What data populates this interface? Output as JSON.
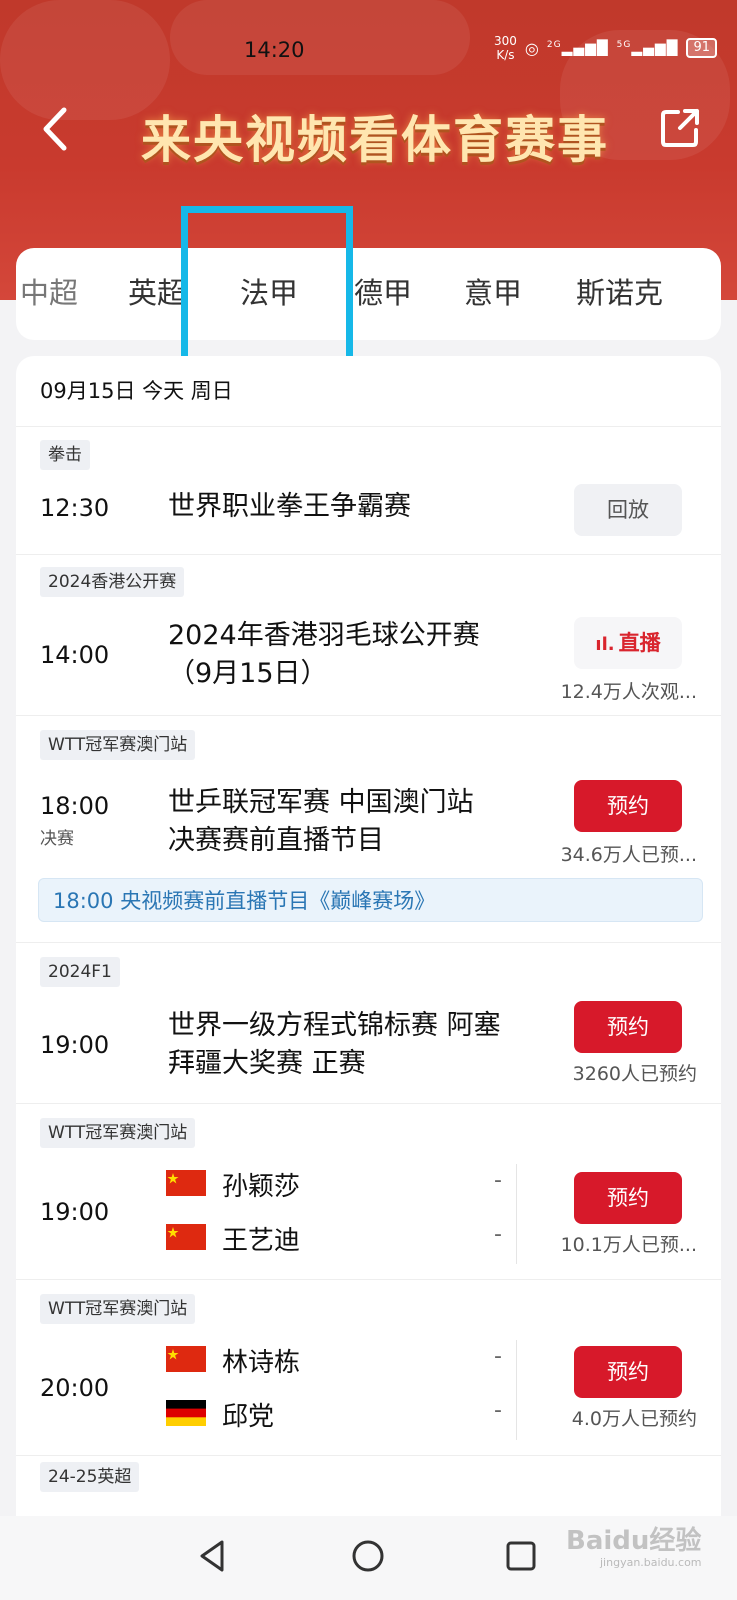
{
  "status": {
    "time": "14:20",
    "net_speed": "300",
    "net_unit": "K/s",
    "sig1": "2G",
    "sig2": "5G",
    "battery": "91"
  },
  "header": {
    "title": "来央视频看体育赛事"
  },
  "tabs": [
    "中超",
    "英超",
    "法甲",
    "德甲",
    "意甲",
    "斯诺克"
  ],
  "date_header": "09月15日 今天 周日",
  "events": [
    {
      "tag": "拳击",
      "time": "12:30",
      "name": "世界职业拳王争霸赛",
      "button": "回放"
    },
    {
      "tag": "2024香港公开赛",
      "time": "14:00",
      "name_line1": "2024年香港羽毛球公开赛",
      "name_line2": "（9月15日）",
      "button": "直播",
      "count": "12.4万人次观..."
    },
    {
      "tag": "WTT冠军赛澳门站",
      "time": "18:00",
      "sub": "决赛",
      "name_line1": "世乒联冠军赛 中国澳门站",
      "name_line2": "决赛赛前直播节目",
      "button": "预约",
      "count": "34.6万人已预...",
      "note": "18:00 央视频赛前直播节目《巅峰赛场》"
    },
    {
      "tag": "2024F1",
      "time": "19:00",
      "name_line1": "世界一级方程式锦标赛 阿塞",
      "name_line2": "拜疆大奖赛 正赛",
      "button": "预约",
      "count": "3260人已预约"
    },
    {
      "tag": "WTT冠军赛澳门站",
      "time": "19:00",
      "player1": "孙颖莎",
      "player2": "王艺迪",
      "score1": "-",
      "score2": "-",
      "button": "预约",
      "count": "10.1万人已预..."
    },
    {
      "tag": "WTT冠军赛澳门站",
      "time": "20:00",
      "player1": "林诗栋",
      "player2": "邱党",
      "score1": "-",
      "score2": "-",
      "button": "预约",
      "count": "4.0万人已预约"
    },
    {
      "tag": "24-25英超"
    }
  ],
  "watermark": {
    "brand": "Baidu经验",
    "site": "jingyan.baidu.com"
  },
  "colors": {
    "primary_red": "#d7192a",
    "header_red": "#c0392b",
    "highlight_box": "#16b8e8",
    "note_blue": "#2a76b4"
  }
}
